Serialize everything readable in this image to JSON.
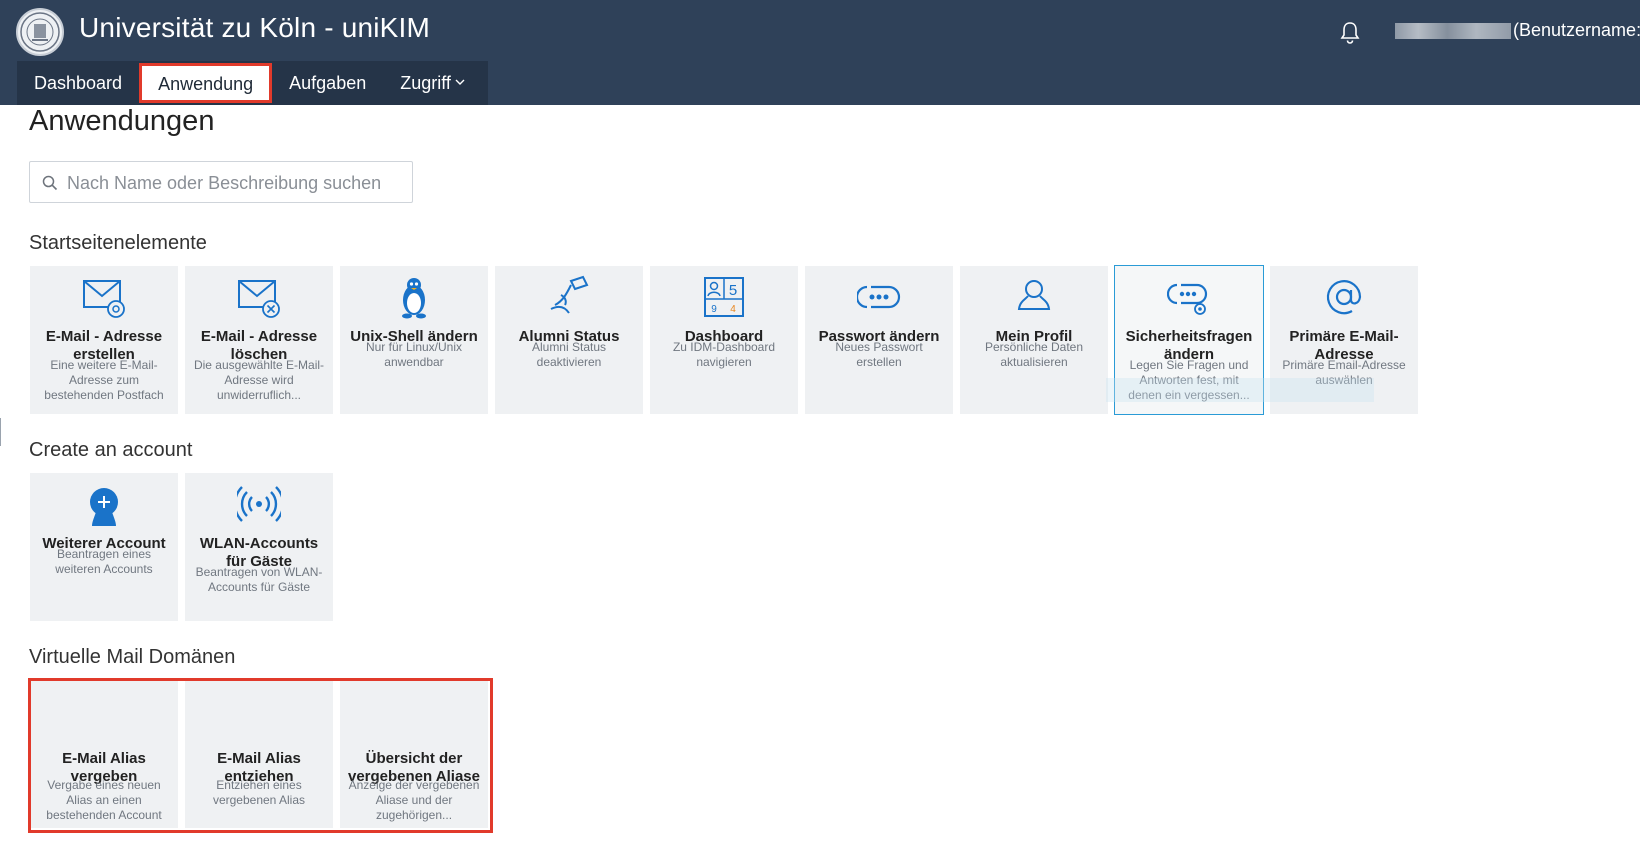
{
  "header": {
    "title": "Universität zu Köln - uniKIM",
    "user_label": "(Benutzername:"
  },
  "nav": {
    "items": [
      {
        "label": "Dashboard"
      },
      {
        "label": "Anwendung"
      },
      {
        "label": "Aufgaben"
      },
      {
        "label": "Zugriff"
      }
    ]
  },
  "page": {
    "title": "Anwendungen",
    "search_placeholder": "Nach Name oder Beschreibung suchen"
  },
  "sections": [
    {
      "title": "Startseitenelemente",
      "tiles": [
        {
          "title": "E-Mail - Adresse erstellen",
          "desc": "Eine weitere E-Mail-Adresse zum bestehenden Postfach",
          "icon": "mail-at-icon"
        },
        {
          "title": "E-Mail - Adresse löschen",
          "desc": "Die ausgewählte E-Mail-Adresse wird unwiderruflich...",
          "icon": "mail-remove-icon"
        },
        {
          "title": "Unix-Shell ändern",
          "desc": "Nur für Linux/Unix anwendbar",
          "icon": "linux-penguin-icon"
        },
        {
          "title": "Alumni Status",
          "desc": "Alumni Status deaktivieren",
          "icon": "alumni-icon"
        },
        {
          "title": "Dashboard",
          "desc": "Zu IDM-Dashboard navigieren",
          "icon": "dashboard-icon",
          "badge_top": "5",
          "badge_left": "9",
          "badge_right": "4"
        },
        {
          "title": "Passwort ändern",
          "desc": "Neues Passwort erstellen",
          "icon": "password-icon"
        },
        {
          "title": "Mein Profil",
          "desc": "Persönliche Daten aktualisieren",
          "icon": "profile-icon"
        },
        {
          "title": "Sicherheitsfragen ändern",
          "desc": "Legen Sie Fragen und Antworten fest, mit denen ein vergessen...",
          "icon": "security-question-icon"
        },
        {
          "title": "Primäre E-Mail-Adresse",
          "desc": "Primäre Email-Adresse auswählen",
          "icon": "at-sign-icon"
        }
      ]
    },
    {
      "title": "Create an account",
      "tiles": [
        {
          "title": "Weiterer Account",
          "desc": "Beantragen eines weiteren Accounts",
          "icon": "add-account-icon"
        },
        {
          "title": "WLAN-Accounts für Gäste",
          "desc": "Beantragen von WLAN-Accounts für Gäste",
          "icon": "wifi-broadcast-icon"
        }
      ]
    },
    {
      "title": "Virtuelle Mail Domänen",
      "tiles": [
        {
          "title": "E-Mail Alias vergeben",
          "desc": "Vergabe eines neuen Alias an einen bestehenden Account"
        },
        {
          "title": "E-Mail Alias entziehen",
          "desc": "Entziehen eines vergebenen Alias"
        },
        {
          "title": "Übersicht der vergebenen Aliase",
          "desc": "Anzeige der vergebenen Aliase und der zugehörigen..."
        }
      ]
    }
  ],
  "colors": {
    "header_bg": "#2f4159",
    "nav_bg": "#253448",
    "tile_bg": "#eff1f3",
    "icon_blue": "#1a73c9",
    "highlight_red": "#e13a2b",
    "selected_border": "#2a9bd6"
  }
}
